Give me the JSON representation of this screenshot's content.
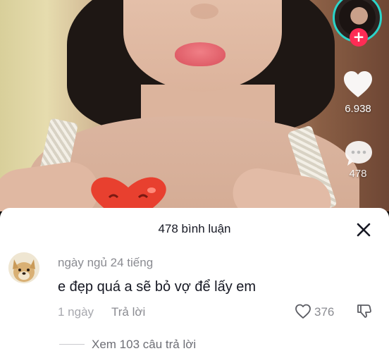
{
  "video": {
    "like_count": "6.938",
    "comment_count": "478"
  },
  "icons": {
    "like": "heart-icon",
    "comment": "speech-bubble-icon",
    "follow": "plus-icon",
    "close": "close-icon",
    "comment_like": "heart-outline-icon",
    "dislike": "thumbs-down-icon"
  },
  "colors": {
    "follow_accent": "#fe2c55",
    "avatar_ring": "#2bd4c9",
    "sheet_bg": "#ffffff"
  },
  "comments_sheet": {
    "title": "478 bình luận",
    "comment": {
      "username": "ngày ngủ 24 tiếng",
      "text": "e đẹp quá a sẽ bỏ vợ để lấy em",
      "time": "1 ngày",
      "reply_label": "Trả lời",
      "like_count": "376"
    },
    "view_replies": "Xem 103 câu trả lời"
  }
}
